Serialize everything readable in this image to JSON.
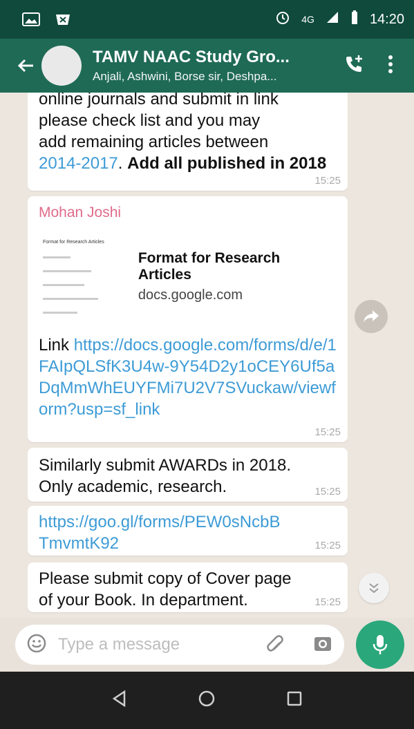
{
  "status_bar": {
    "network": "4G",
    "time": "14:20"
  },
  "header": {
    "title": "TAMV NAAC Study Gro...",
    "subtitle": "Anjali, Ashwini, Borse sir, Deshpa..."
  },
  "messages": [
    {
      "text_lines": [
        "online journals and submit in link",
        "please check list and you may",
        "add remaining articles between"
      ],
      "link_text": "2014-2017",
      "bold_text": "Add all published in 2018",
      "time": "15:25"
    },
    {
      "sender": "Mohan Joshi",
      "preview_title": "Format for Research Articles",
      "preview_domain": "docs.google.com",
      "link_prefix": "Link",
      "link_url": "https://docs.google.com/forms/d/e/1FAIpQLSfK3U4w-9Y54D2y1oCEY6Uf5aDqMmWhEUYFMi7U2V7SVuckaw/viewform?usp=sf_link",
      "time": "15:25",
      "thumb_title": "Format for Research Articles"
    },
    {
      "text": "Similarly submit AWARDs in 2018. Only academic, research.",
      "time": "15:25"
    },
    {
      "link_url": "https://goo.gl/forms/PEW0sNcbBTmvmtK92",
      "time": "15:25"
    },
    {
      "text": "Please submit copy of Cover page of your Book. In department.",
      "time": "15:25"
    }
  ],
  "composer": {
    "placeholder": "Type a message"
  },
  "colors": {
    "app_bar": "#1f6a55",
    "status_bar": "#0f4a3c",
    "link": "#3d9bd6",
    "sender": "#e06b89",
    "mic_button": "#2aa77b"
  },
  "icons": {
    "back": "arrow-left-icon",
    "add_call": "add-call-icon",
    "menu": "kebab-menu-icon",
    "emoji": "emoji-icon",
    "attach": "paperclip-icon",
    "camera": "camera-icon",
    "mic": "mic-icon",
    "forward": "forward-icon",
    "scroll_down": "double-chevron-down-icon",
    "nav_back": "nav-back-icon",
    "nav_home": "nav-home-icon",
    "nav_recents": "nav-recents-icon"
  }
}
